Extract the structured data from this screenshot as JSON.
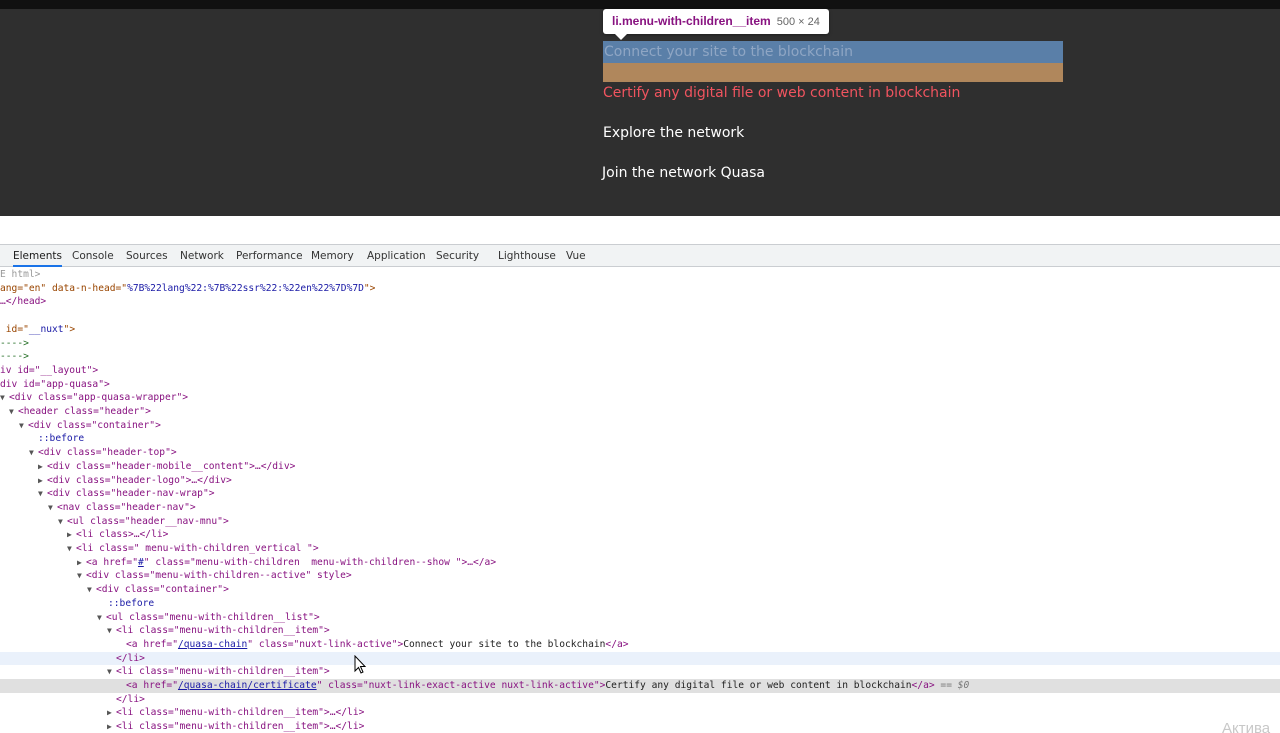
{
  "tooltip": {
    "selector": "li.menu-with-children__item",
    "size": "500 × 24"
  },
  "site_menu": [
    "Connect your site to the blockchain",
    "Certify any digital file or web content in blockchain",
    "Explore the network",
    "Join the network Quasa"
  ],
  "devtools": {
    "tabs": [
      "Elements",
      "Console",
      "Sources",
      "Network",
      "Performance",
      "Memory",
      "Application",
      "Security",
      "Lighthouse",
      "Vue"
    ],
    "active_tab": "Elements",
    "tree": {
      "l0": "E html>",
      "l1a": "ang=\"en\" data-n-head=\"",
      "l1b": "%7B%22lang%22:%7B%22ssr%22:%22en%22%7D%7D",
      "l1c": "\">",
      "l2": "…</head>",
      "l3a": " id=\"",
      "l3b": "__nuxt",
      "l3c": "\">",
      "l4": "---->",
      "l5": "---->",
      "l6": "iv id=\"__layout\">",
      "l7": "div id=\"app-quasa\">",
      "l8": "<div class=\"app-quasa-wrapper\">",
      "l9": "<header class=\"header\">",
      "l10": "<div class=\"container\">",
      "l11": "::before",
      "l12": "<div class=\"header-top\">",
      "l13": "<div class=\"header-mobile__content\">…</div>",
      "l14": "<div class=\"header-logo\">…</div>",
      "l15": "<div class=\"header-nav-wrap\">",
      "l16": "<nav class=\"header-nav\">",
      "l17": "<ul class=\"header__nav-mnu\">",
      "l18": "<li class>…</li>",
      "l19": "<li class=\" menu-with-children_vertical \">",
      "l20a": "<a href=\"",
      "l20b": "#",
      "l20c": "\" class=\"menu-with-children  menu-with-children--show \">…</a>",
      "l21": "<div class=\"menu-with-children--active\" style>",
      "l22": "<div class=\"container\">",
      "l23": "::before",
      "l24": "<ul class=\"menu-with-children__list\">",
      "l25": "<li class=\"menu-with-children__item\">",
      "l26a": "<a href=\"",
      "l26b": "/quasa-chain",
      "l26c": "\" class=\"nuxt-link-active\">",
      "l26d": "Connect your site to the blockchain",
      "l26e": "</a>",
      "l27": "</li>",
      "l28": "<li class=\"menu-with-children__item\">",
      "l29a": "<a href=\"",
      "l29b": "/quasa-chain/certificate",
      "l29c": "\" class=\"nuxt-link-exact-active nuxt-link-active\">",
      "l29d": "Certify any digital file or web content in blockchain",
      "l29e": "</a>",
      "l29f": " == $0",
      "l30": "</li>",
      "l31": "<li class=\"menu-with-children__item\">…</li>",
      "l32": "<li class=\"menu-with-children__item\">…</li>"
    }
  },
  "watermark": "Актива"
}
